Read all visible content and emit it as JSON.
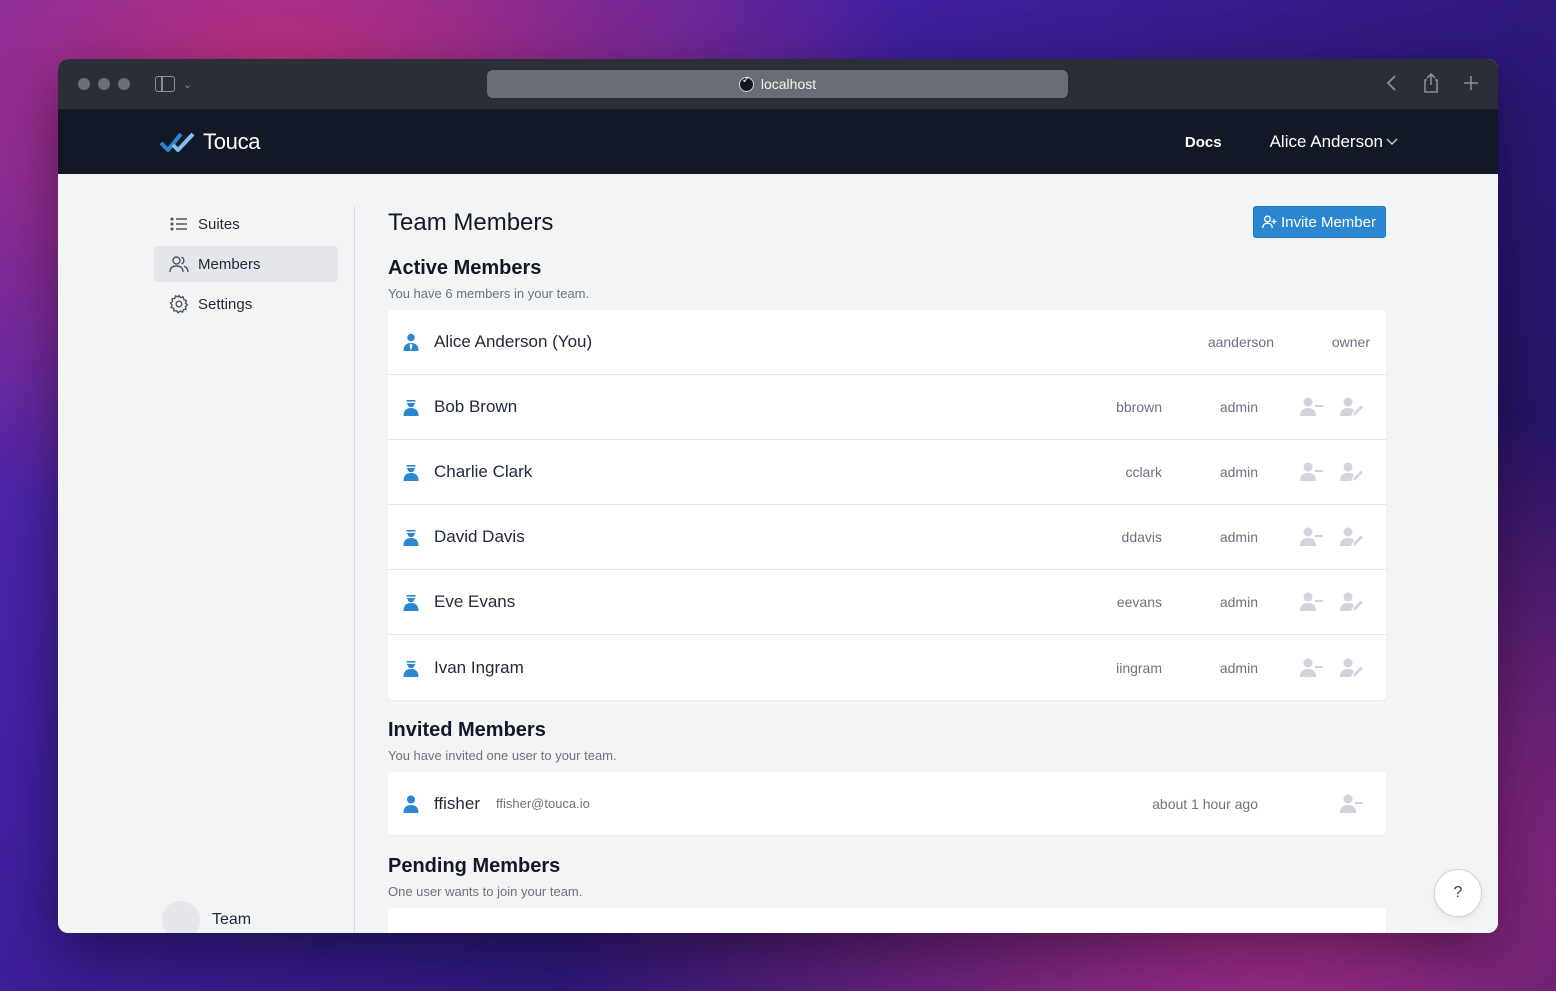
{
  "browser": {
    "url": "localhost"
  },
  "header": {
    "logo_text": "Touca",
    "docs_label": "Docs",
    "user_name": "Alice Anderson"
  },
  "sidebar": {
    "items": [
      {
        "label": "Suites",
        "icon": "list-icon"
      },
      {
        "label": "Members",
        "icon": "users-icon",
        "active": true
      },
      {
        "label": "Settings",
        "icon": "gear-icon"
      }
    ],
    "team_label": "Team"
  },
  "main": {
    "title": "Team Members",
    "invite_button": "Invite Member",
    "active": {
      "title": "Active Members",
      "subtitle": "You have 6 members in your team.",
      "members": [
        {
          "name": "Alice Anderson (You)",
          "username": "aanderson",
          "role": "owner"
        },
        {
          "name": "Bob Brown",
          "username": "bbrown",
          "role": "admin"
        },
        {
          "name": "Charlie Clark",
          "username": "cclark",
          "role": "admin"
        },
        {
          "name": "David Davis",
          "username": "ddavis",
          "role": "admin"
        },
        {
          "name": "Eve Evans",
          "username": "eevans",
          "role": "admin"
        },
        {
          "name": "Ivan Ingram",
          "username": "iingram",
          "role": "admin"
        }
      ]
    },
    "invited": {
      "title": "Invited Members",
      "subtitle": "You have invited one user to your team.",
      "members": [
        {
          "name": "ffisher",
          "email": "ffisher@touca.io",
          "time": "about 1 hour ago"
        }
      ]
    },
    "pending": {
      "title": "Pending Members",
      "subtitle": "One user wants to join your team."
    }
  },
  "help": {
    "label": "?"
  },
  "colors": {
    "accent": "#2b88d0",
    "header_bg": "#131826",
    "page_bg": "#f3f4f6"
  }
}
